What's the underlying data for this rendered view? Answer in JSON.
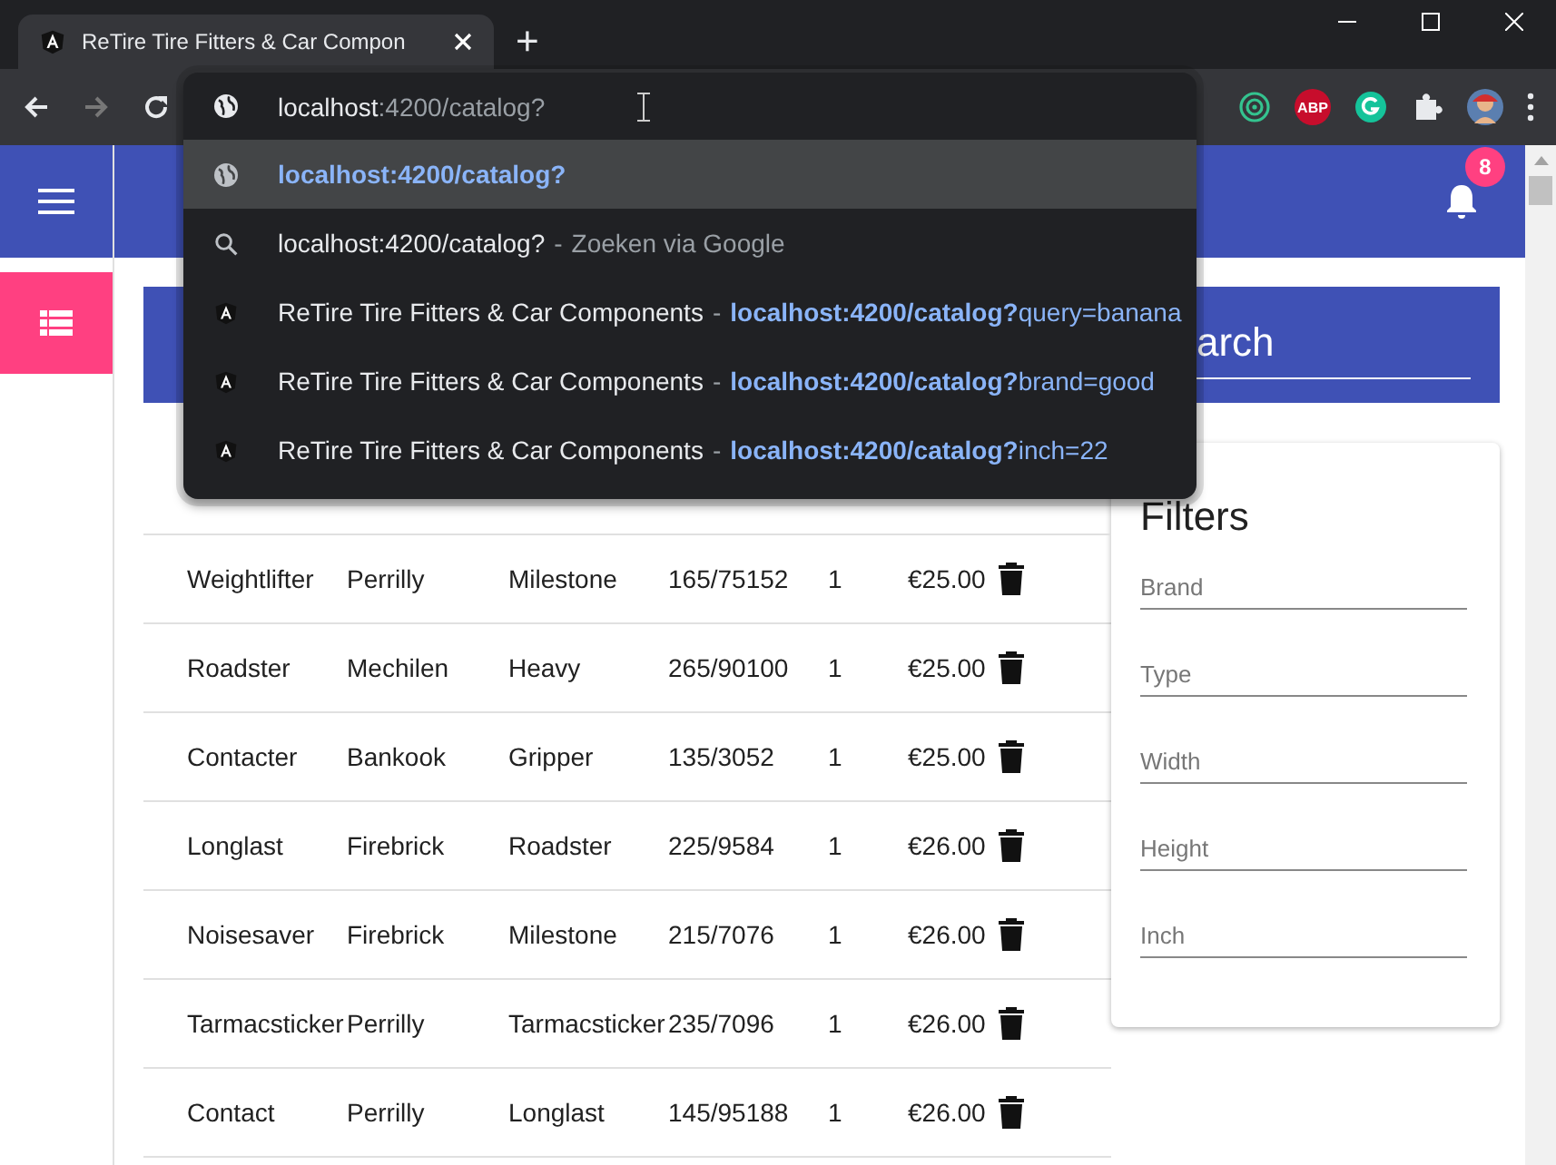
{
  "browser": {
    "tab": {
      "title": "ReTire Tire Fitters & Car Compon",
      "selected": true
    },
    "new_tab": "+",
    "forward_disabled": true,
    "address": {
      "host": "localhost",
      "path": ":4200/catalog?"
    },
    "abp_label": "ABP"
  },
  "suggestions": [
    {
      "kind": "url",
      "selected": true,
      "text": "localhost:4200/catalog?"
    },
    {
      "kind": "search",
      "selected": false,
      "text": "localhost:4200/catalog?",
      "separator": "-",
      "detail": "Zoeken via Google"
    },
    {
      "kind": "history",
      "selected": false,
      "text": "ReTire Tire Fitters & Car Components",
      "separator": "-",
      "url_match": "localhost:4200/catalog?",
      "url_rest": "query=banana"
    },
    {
      "kind": "history",
      "selected": false,
      "text": "ReTire Tire Fitters & Car Components",
      "separator": "-",
      "url_match": "localhost:4200/catalog?",
      "url_rest": "brand=good"
    },
    {
      "kind": "history",
      "selected": false,
      "text": "ReTire Tire Fitters & Car Components",
      "separator": "-",
      "url_match": "localhost:4200/catalog?",
      "url_rest": "inch=22"
    }
  ],
  "app": {
    "notification_count": "8",
    "search": {
      "value": "arch"
    },
    "table": {
      "rows": [
        {
          "name": "Weightlifter",
          "brand": "Perrilly",
          "type": "Milestone",
          "size": "165/75152",
          "days": "1",
          "price": "€25.00"
        },
        {
          "name": "Roadster",
          "brand": "Mechilen",
          "type": "Heavy",
          "size": "265/90100",
          "days": "1",
          "price": "€25.00"
        },
        {
          "name": "Contacter",
          "brand": "Bankook",
          "type": "Gripper",
          "size": "135/3052",
          "days": "1",
          "price": "€25.00"
        },
        {
          "name": "Longlast",
          "brand": "Firebrick",
          "type": "Roadster",
          "size": "225/9584",
          "days": "1",
          "price": "€26.00"
        },
        {
          "name": "Noisesaver",
          "brand": "Firebrick",
          "type": "Milestone",
          "size": "215/7076",
          "days": "1",
          "price": "€26.00"
        },
        {
          "name": "Tarmacsticker",
          "brand": "Perrilly",
          "type": "Tarmacsticker",
          "size": "235/7096",
          "days": "1",
          "price": "€26.00"
        },
        {
          "name": "Contact",
          "brand": "Perrilly",
          "type": "Longlast",
          "size": "145/95188",
          "days": "1",
          "price": "€26.00"
        }
      ]
    },
    "filters": {
      "title": "Filters",
      "fields": [
        {
          "placeholder": "Brand"
        },
        {
          "placeholder": "Type"
        },
        {
          "placeholder": "Width"
        },
        {
          "placeholder": "Height"
        },
        {
          "placeholder": "Inch"
        }
      ]
    }
  }
}
